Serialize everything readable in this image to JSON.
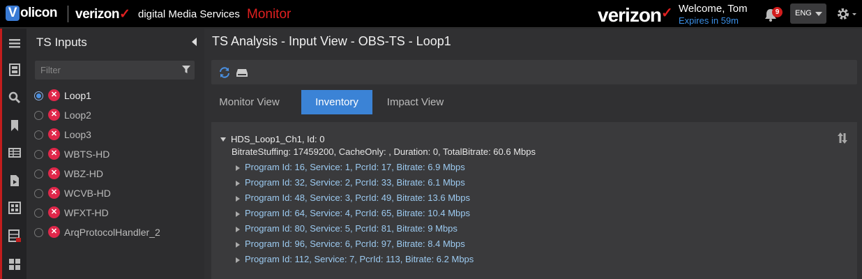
{
  "header": {
    "volicon_logo": "Volicon",
    "verizon_small": "verizon",
    "service": "digital Media Services",
    "product": "Monitor",
    "verizon_big": "verizon",
    "welcome": "Welcome, Tom",
    "expires": "Expires in 59m",
    "notification_count": "9",
    "language": "ENG",
    "accent_red": "#e02020",
    "link_blue": "#3b8fe6"
  },
  "leftnav": {
    "icons": [
      "menu-icon",
      "film-icon",
      "search-icon",
      "bookmark-icon",
      "table-icon",
      "file-play-icon",
      "grid-window-icon",
      "video-grid-icon",
      "tiles-icon"
    ]
  },
  "ts_panel": {
    "title": "TS Inputs",
    "filter_placeholder": "Filter",
    "items": [
      {
        "label": "Loop1",
        "selected": true,
        "status": "error"
      },
      {
        "label": "Loop2",
        "selected": false,
        "status": "error"
      },
      {
        "label": "Loop3",
        "selected": false,
        "status": "error"
      },
      {
        "label": "WBTS-HD",
        "selected": false,
        "status": "error"
      },
      {
        "label": "WBZ-HD",
        "selected": false,
        "status": "error"
      },
      {
        "label": "WCVB-HD",
        "selected": false,
        "status": "error"
      },
      {
        "label": "WFXT-HD",
        "selected": false,
        "status": "error"
      },
      {
        "label": "ArqProtocolHandler_2",
        "selected": false,
        "status": "error"
      }
    ]
  },
  "main": {
    "title": "TS Analysis - Input View - OBS-TS - Loop1",
    "tabs": [
      {
        "label": "Monitor View",
        "active": false
      },
      {
        "label": "Inventory",
        "active": true
      },
      {
        "label": "Impact View",
        "active": false
      }
    ],
    "tree": {
      "root": "HDS_Loop1_Ch1, Id: 0",
      "info": "BitrateStuffing: 17459200, CacheOnly: , Duration: 0, TotalBitrate: 60.6 Mbps",
      "programs": [
        "Program Id: 16, Service: 1, PcrId: 17, Bitrate: 6.9 Mbps",
        "Program Id: 32, Service: 2, PcrId: 33, Bitrate: 6.1 Mbps",
        "Program Id: 48, Service: 3, PcrId: 49, Bitrate: 13.6 Mbps",
        "Program Id: 64, Service: 4, PcrId: 65, Bitrate: 10.4 Mbps",
        "Program Id: 80, Service: 5, PcrId: 81, Bitrate: 9 Mbps",
        "Program Id: 96, Service: 6, PcrId: 97, Bitrate: 8.4 Mbps",
        "Program Id: 112, Service: 7, PcrId: 113, Bitrate: 6.2 Mbps"
      ]
    }
  }
}
